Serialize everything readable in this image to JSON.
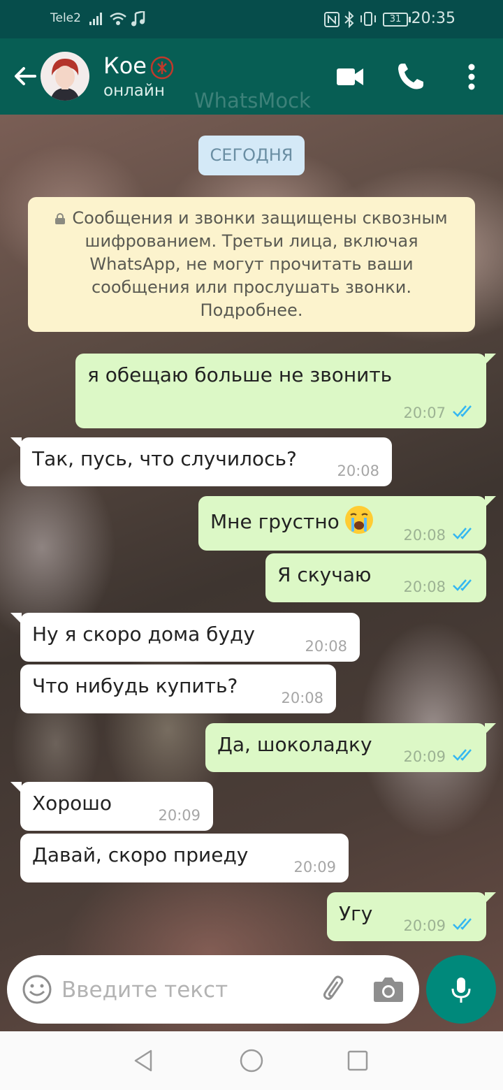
{
  "status_bar": {
    "carrier": "Tele2",
    "time": "20:35",
    "battery": "31"
  },
  "header": {
    "name": "Кое",
    "status": "онлайн",
    "watermark": "WhatsMock"
  },
  "date_chip": "СЕГОДНЯ",
  "system_message": "Сообщения и звонки защищены сквозным шифрованием. Третьи лица, включая WhatsApp, не могут прочитать ваши сообщения или прослушать звонки. Подробнее.",
  "messages": [
    {
      "dir": "out",
      "text": "я обещаю больше не звонить",
      "time": "20:07",
      "read": true
    },
    {
      "dir": "in",
      "text": "Так, пусь, что случилось?",
      "time": "20:08"
    },
    {
      "dir": "out",
      "text": "Мне грустно",
      "emoji": "loudly-crying-face",
      "time": "20:08",
      "read": true
    },
    {
      "dir": "out",
      "text": "Я скучаю",
      "time": "20:08",
      "read": true
    },
    {
      "dir": "in",
      "text": "Ну я скоро дома буду",
      "time": "20:08"
    },
    {
      "dir": "in",
      "text": "Что нибудь купить?",
      "time": "20:08"
    },
    {
      "dir": "out",
      "text": "Да, шоколадку",
      "time": "20:09",
      "read": true
    },
    {
      "dir": "in",
      "text": "Хорошо",
      "time": "20:09"
    },
    {
      "dir": "in",
      "text": "Давай, скоро приеду",
      "time": "20:09"
    },
    {
      "dir": "out",
      "text": "Угу",
      "time": "20:09",
      "read": true
    }
  ],
  "input": {
    "placeholder": "Введите текст"
  },
  "colors": {
    "header": "#075e54",
    "status_bar": "#064d4b",
    "outgoing": "#dcf8c6",
    "incoming": "#ffffff",
    "read_ticks": "#34b7f1",
    "fab": "#00897b"
  },
  "icons": [
    "back-arrow-icon",
    "video-call-icon",
    "phone-icon",
    "more-vert-icon",
    "emoji-icon",
    "attach-icon",
    "camera-icon",
    "mic-icon",
    "nav-back-icon",
    "nav-home-icon",
    "nav-recents-icon"
  ]
}
